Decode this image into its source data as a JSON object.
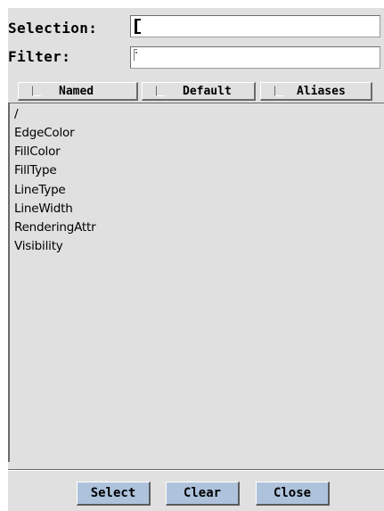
{
  "selection": {
    "label": "Selection:",
    "value": ""
  },
  "filter": {
    "label": "Filter:",
    "value": ""
  },
  "toggles": [
    {
      "label": "Named",
      "checked": false
    },
    {
      "label": "Default",
      "checked": false
    },
    {
      "label": "Aliases",
      "checked": false
    }
  ],
  "list_items": [
    "/",
    "EdgeColor",
    "FillColor",
    "FillType",
    "LineType",
    "LineWidth",
    "RenderingAttr",
    "Visibility"
  ],
  "buttons": {
    "select": "Select",
    "clear": "Clear",
    "close": "Close"
  },
  "colors": {
    "panel": "#e0e0e0",
    "button": "#aec2dc",
    "shadow": "#6a6a6a"
  }
}
